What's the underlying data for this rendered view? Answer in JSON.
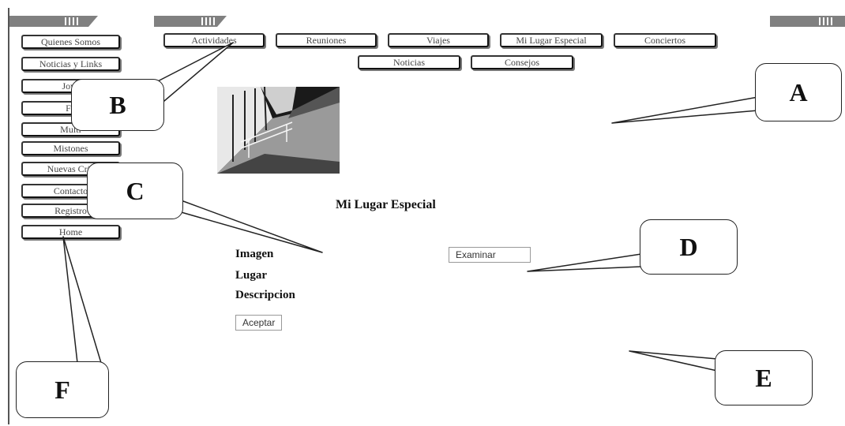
{
  "top_nav": {
    "row1": [
      "Actividades",
      "Reuniones",
      "Viajes",
      "Mi Lugar Especial",
      "Conciertos"
    ],
    "row2": [
      "Noticias",
      "Consejos"
    ]
  },
  "side_nav": [
    "Quienes Somos",
    "Noticias y Links",
    "Jove",
    "Fo",
    "Multi",
    "Mistones",
    "Nuevas Cria",
    "Contacto",
    "Registro",
    "Home"
  ],
  "content": {
    "title": "Mi Lugar Especial",
    "fields": {
      "imagen": "Imagen",
      "lugar": "Lugar",
      "descripcion": "Descripcion"
    },
    "browse_button": "Examinar",
    "submit_button": "Aceptar"
  },
  "callouts": [
    "A",
    "B",
    "C",
    "D",
    "E",
    "F"
  ]
}
